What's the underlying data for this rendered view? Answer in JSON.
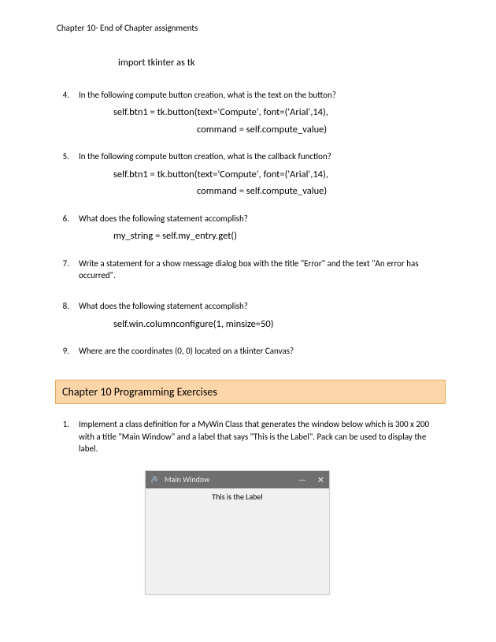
{
  "header": "Chapter 10- End of Chapter assignments",
  "import_line": "import tkinter as tk",
  "questions": [
    {
      "num": "4.",
      "text": "In the following compute button creation, what is the text on the button?",
      "code": [
        "self.btn1 = tk.button(text='Compute', font=('Arial',14),",
        "command = self.compute_value)"
      ]
    },
    {
      "num": "5.",
      "text": "In the following compute button creation, what is the callback function?",
      "code": [
        "self.btn1 = tk.button(text='Compute', font=('Arial',14),",
        "command = self.compute_value)"
      ]
    },
    {
      "num": "6.",
      "text": "What does the following statement accomplish?",
      "code_single": "my_string = self.my_entry.get()"
    },
    {
      "num": "7.",
      "text": "Write a statement for a show message dialog box with the title \"Error\" and the text \"An error has occurred\"."
    },
    {
      "num": "8.",
      "text": "What does the following statement accomplish?",
      "code_single": "self.win.columnconfigure(1, minsize=50)"
    },
    {
      "num": "9.",
      "text": "Where are the coordinates (0, 0) located on a tkinter Canvas?"
    }
  ],
  "section_title": "Chapter 10 Programming Exercises",
  "exercises": [
    {
      "num": "1.",
      "text": "Implement a class definition for a MyWin Class that generates the window below which is 300 x 200 with a title \"Main Window\" and a label that says \"This is the Label\".  Pack can be used to display the label."
    }
  ],
  "window": {
    "title": "Main Window",
    "label": "This is the Label",
    "minimize": "—",
    "close": "✕"
  }
}
